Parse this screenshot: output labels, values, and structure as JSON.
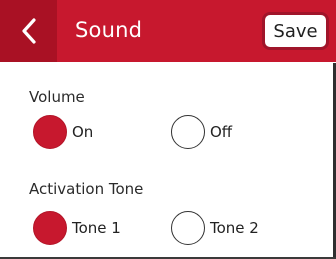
{
  "header": {
    "title": "Sound",
    "back_icon": "chevron-left-icon",
    "save_label": "Save"
  },
  "colors": {
    "accent": "#c7182e",
    "accent_dark": "#a91124"
  },
  "volume": {
    "label": "Volume",
    "options": [
      {
        "label": "On",
        "checked": true
      },
      {
        "label": "Off",
        "checked": false
      }
    ]
  },
  "activation_tone": {
    "label": "Activation Tone",
    "options": [
      {
        "label": "Tone 1",
        "checked": true
      },
      {
        "label": "Tone 2",
        "checked": false
      }
    ]
  }
}
